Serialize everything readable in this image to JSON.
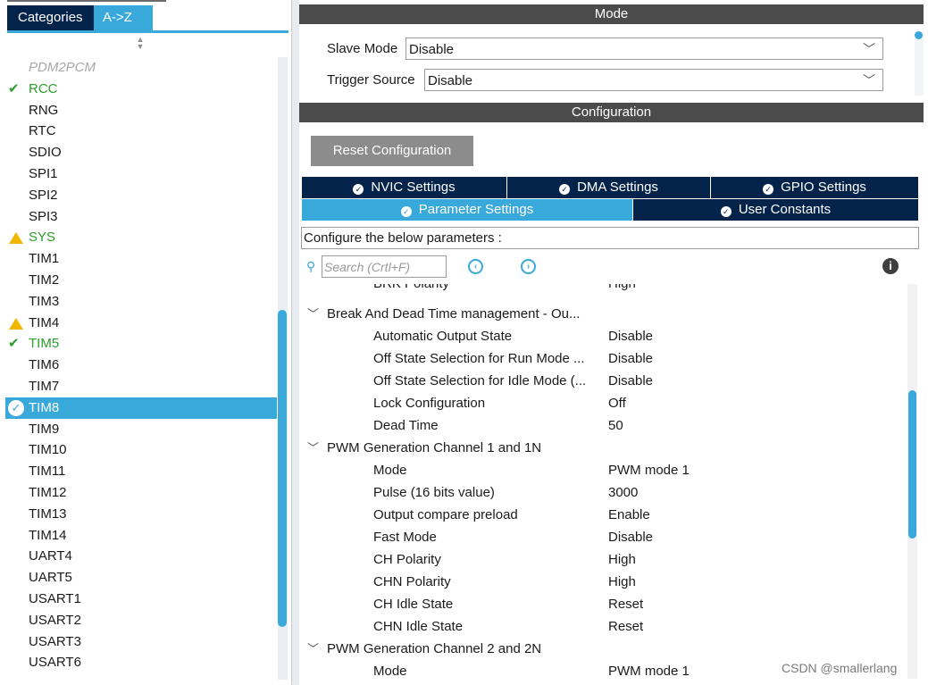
{
  "left_panel": {
    "tabs": {
      "categories": "Categories",
      "az": "A->Z"
    },
    "items": [
      {
        "label": "PDM2PCM",
        "state": "disabled"
      },
      {
        "label": "RCC",
        "state": "checked"
      },
      {
        "label": "RNG",
        "state": "normal"
      },
      {
        "label": "RTC",
        "state": "normal"
      },
      {
        "label": "SDIO",
        "state": "normal"
      },
      {
        "label": "SPI1",
        "state": "normal"
      },
      {
        "label": "SPI2",
        "state": "normal"
      },
      {
        "label": "SPI3",
        "state": "normal"
      },
      {
        "label": "SYS",
        "state": "warning"
      },
      {
        "label": "TIM1",
        "state": "normal"
      },
      {
        "label": "TIM2",
        "state": "normal"
      },
      {
        "label": "TIM3",
        "state": "normal"
      },
      {
        "label": "TIM4",
        "state": "warning-normal"
      },
      {
        "label": "TIM5",
        "state": "checked"
      },
      {
        "label": "TIM6",
        "state": "normal"
      },
      {
        "label": "TIM7",
        "state": "normal"
      },
      {
        "label": "TIM8",
        "state": "selected"
      },
      {
        "label": "TIM9",
        "state": "normal"
      },
      {
        "label": "TIM10",
        "state": "normal"
      },
      {
        "label": "TIM11",
        "state": "normal"
      },
      {
        "label": "TIM12",
        "state": "normal"
      },
      {
        "label": "TIM13",
        "state": "normal"
      },
      {
        "label": "TIM14",
        "state": "normal"
      },
      {
        "label": "UART4",
        "state": "normal"
      },
      {
        "label": "UART5",
        "state": "normal"
      },
      {
        "label": "USART1",
        "state": "normal"
      },
      {
        "label": "USART2",
        "state": "normal"
      },
      {
        "label": "USART3",
        "state": "normal"
      },
      {
        "label": "USART6",
        "state": "normal"
      }
    ],
    "icons": {
      "checked": "check-icon",
      "warning": "warning-icon",
      "selected": "check-circle-icon"
    }
  },
  "mode": {
    "title": "Mode",
    "slave_mode": {
      "label": "Slave Mode",
      "value": "Disable"
    },
    "trigger_source": {
      "label": "Trigger Source",
      "value": "Disable"
    }
  },
  "configuration": {
    "title": "Configuration",
    "reset_button": "Reset Configuration",
    "tabs": {
      "nvic": "NVIC Settings",
      "dma": "DMA Settings",
      "gpio": "GPIO Settings",
      "parameter": "Parameter Settings",
      "user_constants": "User Constants"
    },
    "configure_label": "Configure the below parameters :",
    "search_placeholder": "Search (Crtl+F)",
    "params": [
      {
        "kind": "cut",
        "name": "BRK Polarity",
        "value": "High"
      },
      {
        "kind": "group",
        "name": "Break And Dead Time management - Ou..."
      },
      {
        "kind": "item",
        "name": "Automatic Output State",
        "value": "Disable"
      },
      {
        "kind": "item",
        "name": "Off State Selection for Run Mode ...",
        "value": "Disable"
      },
      {
        "kind": "item",
        "name": "Off State Selection for Idle Mode (...",
        "value": "Disable"
      },
      {
        "kind": "item",
        "name": "Lock Configuration",
        "value": "Off"
      },
      {
        "kind": "item",
        "name": "Dead Time",
        "value": "50"
      },
      {
        "kind": "group",
        "name": "PWM Generation Channel 1 and 1N"
      },
      {
        "kind": "item",
        "name": "Mode",
        "value": "PWM mode 1"
      },
      {
        "kind": "item",
        "name": "Pulse (16 bits value)",
        "value": "3000"
      },
      {
        "kind": "item",
        "name": "Output compare preload",
        "value": "Enable"
      },
      {
        "kind": "item",
        "name": "Fast Mode",
        "value": "Disable"
      },
      {
        "kind": "item",
        "name": "CH Polarity",
        "value": "High"
      },
      {
        "kind": "item",
        "name": "CHN Polarity",
        "value": "High"
      },
      {
        "kind": "item",
        "name": "CH Idle State",
        "value": "Reset"
      },
      {
        "kind": "item",
        "name": "CHN Idle State",
        "value": "Reset"
      },
      {
        "kind": "group",
        "name": "PWM Generation Channel 2 and 2N"
      },
      {
        "kind": "item",
        "name": "Mode",
        "value": "PWM mode 1"
      }
    ]
  },
  "watermark": "CSDN @smallerlang",
  "colors": {
    "accent": "#39a9db",
    "navy": "#03234b",
    "header_bar": "#4b4b4b",
    "ok_green": "#2a9d2a",
    "warning": "#f2b600"
  }
}
